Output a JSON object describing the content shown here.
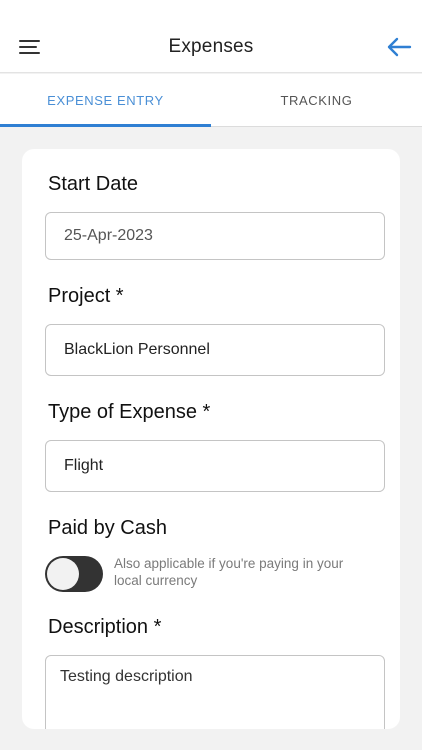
{
  "header": {
    "title": "Expenses",
    "menu_icon": "hamburger-menu-icon",
    "back_icon": "arrow-left-icon",
    "accent_color": "#2f7fd3"
  },
  "tabs": [
    {
      "label": "EXPENSE ENTRY",
      "active": true
    },
    {
      "label": "TRACKING",
      "active": false
    }
  ],
  "form": {
    "start_date": {
      "label": "Start Date",
      "value": "25-Apr-2023"
    },
    "project": {
      "label": "Project *",
      "value": "BlackLion Personnel"
    },
    "expense_type": {
      "label": "Type of Expense *",
      "value": "Flight"
    },
    "paid_by_cash": {
      "label": "Paid by Cash",
      "enabled": false,
      "helper": "Also applicable if you're paying in your local currency"
    },
    "description": {
      "label": "Description *",
      "value": "Testing description"
    }
  }
}
